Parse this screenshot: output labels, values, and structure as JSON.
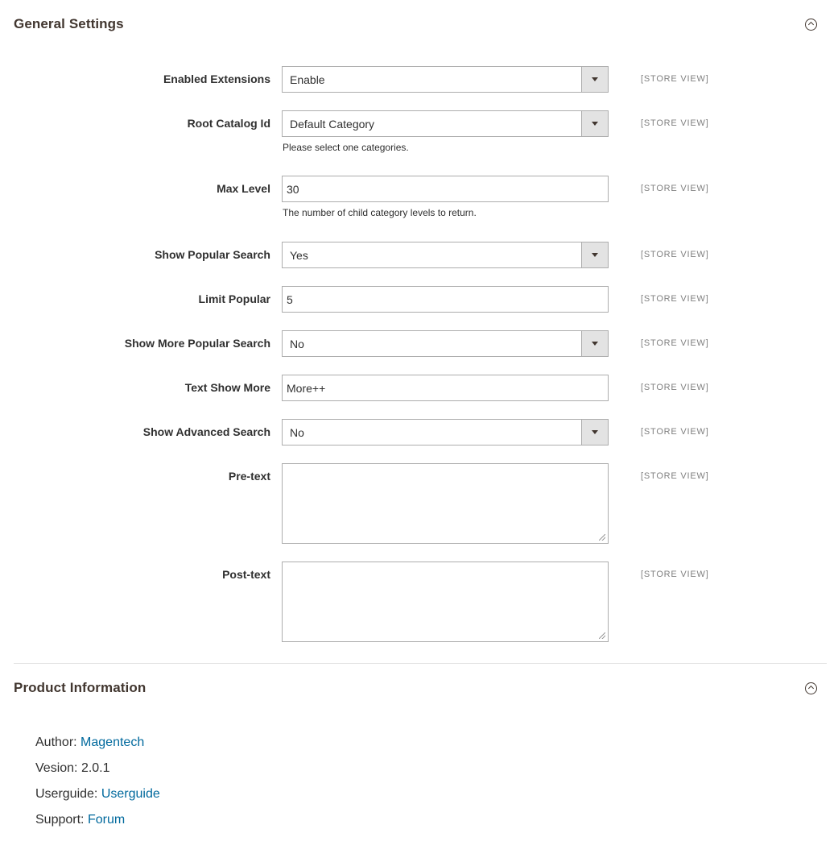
{
  "general": {
    "title": "General Settings",
    "scope": "[STORE VIEW]",
    "fields": {
      "enabled_extensions": {
        "label": "Enabled Extensions",
        "value": "Enable"
      },
      "root_catalog": {
        "label": "Root Catalog Id",
        "value": "Default Category",
        "note": "Please select one categories."
      },
      "max_level": {
        "label": "Max Level",
        "value": "30",
        "note": "The number of child category levels to return."
      },
      "show_popular": {
        "label": "Show Popular Search",
        "value": "Yes"
      },
      "limit_popular": {
        "label": "Limit Popular",
        "value": "5"
      },
      "show_more_popular": {
        "label": "Show More Popular Search",
        "value": "No"
      },
      "text_show_more": {
        "label": "Text Show More",
        "value": "More++"
      },
      "show_advanced": {
        "label": "Show Advanced Search",
        "value": "No"
      },
      "pre_text": {
        "label": "Pre-text",
        "value": ""
      },
      "post_text": {
        "label": "Post-text",
        "value": ""
      }
    }
  },
  "product_info": {
    "title": "Product Information",
    "author_label": "Author:",
    "author_value": "Magentech",
    "version_label": "Vesion:",
    "version_value": "2.0.1",
    "userguide_label": "Userguide:",
    "userguide_value": "Userguide",
    "support_label": "Support:",
    "support_value": "Forum"
  },
  "colors": {
    "link": "#00699d",
    "border": "#adadad",
    "select_button": "#e3e3e3"
  },
  "icons": {
    "section_toggle": "chevron-up-circle-icon",
    "select_arrow": "caret-down-icon"
  }
}
